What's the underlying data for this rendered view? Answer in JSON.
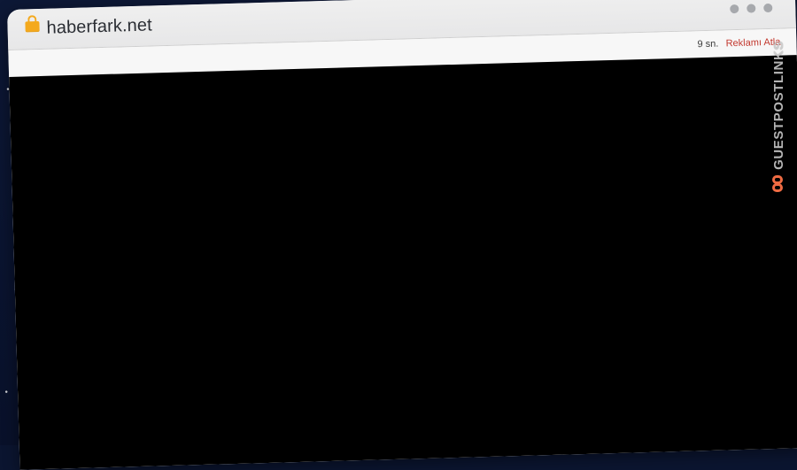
{
  "browser": {
    "address": "haberfark.net"
  },
  "ad_bar": {
    "countdown": "9 sn.",
    "skip_label": "Reklamı Atla"
  },
  "watermark": {
    "text": "GUESTPOSTLINKS",
    "icon": "chain-link-icon"
  },
  "colors": {
    "background": "#0b1530",
    "browser_frame": "#f3f3f4",
    "lock": "#f4a91d",
    "skip_text": "#c2372d",
    "content": "#000000",
    "watermark_icon": "#ef6b43"
  }
}
